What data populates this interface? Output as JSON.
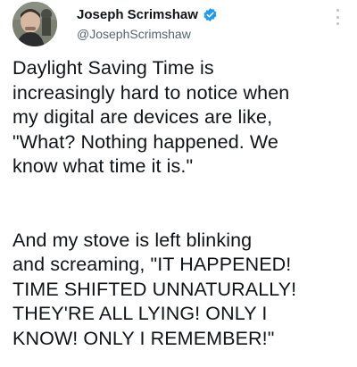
{
  "user": {
    "display_name": "Joseph Scrimshaw",
    "handle": "@JosephScrimshaw",
    "verified_icon": "verified-badge-icon",
    "more_icon": "more-options-icon"
  },
  "tweet": {
    "paragraph1": [
      "Daylight Saving Time is",
      "increasingly hard to notice when",
      "my digital are devices are like,",
      "\"What? Nothing happened. We",
      "know what time it is.\""
    ],
    "paragraph2": [
      "And my stove is left blinking",
      "and screaming, \"IT HAPPENED!",
      "TIME SHIFTED UNNATURALLY!",
      "THEY'RE ALL LYING! ONLY I",
      "KNOW! ONLY I REMEMBER!\""
    ]
  },
  "colors": {
    "verified_blue": "#1d9bf0",
    "handle_gray": "#536471",
    "text": "#0f1419"
  }
}
